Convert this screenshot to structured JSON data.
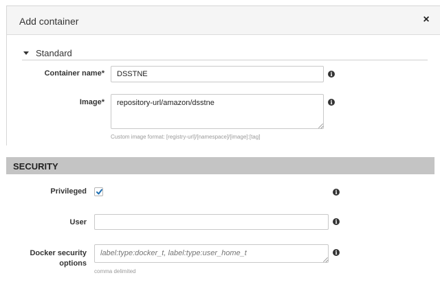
{
  "dialog": {
    "title": "Add container",
    "close_glyph": "×"
  },
  "standard": {
    "section_label": "Standard",
    "container_name": {
      "label": "Container name*",
      "value": "DSSTNE"
    },
    "image": {
      "label": "Image*",
      "value": "repository-url/amazon/dsstne",
      "help": "Custom image format: [registry-url]/[namespace]/[image]:[tag]"
    }
  },
  "security": {
    "section_title": "SECURITY",
    "privileged": {
      "label": "Privileged",
      "checked": true
    },
    "user": {
      "label": "User",
      "value": ""
    },
    "docker_security_options": {
      "label_line1": "Docker security",
      "label_line2": "options",
      "value": "",
      "placeholder": "label:type:docker_t, label:type:user_home_t",
      "help": "comma delimited"
    }
  },
  "icons": {
    "info": "info-icon",
    "caret": "caret-down-icon",
    "close": "close-icon",
    "check": "checkmark-icon"
  },
  "colors": {
    "header_bg": "#f5f5f5",
    "security_bar": "#c4c4c4",
    "checkbox_mark": "#1f6fb2"
  }
}
